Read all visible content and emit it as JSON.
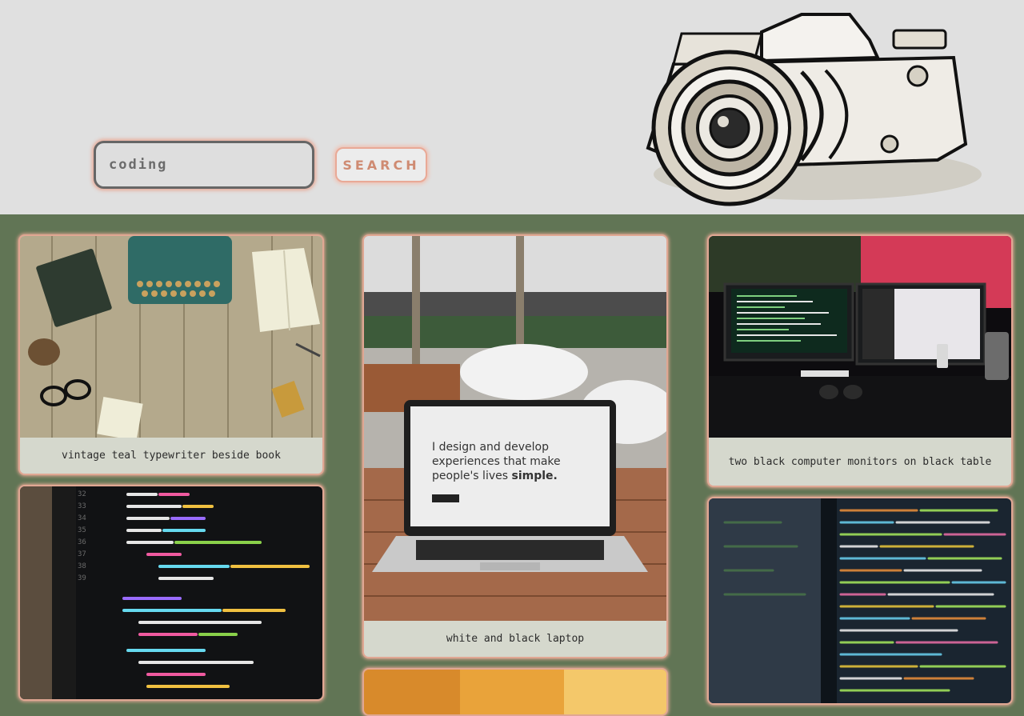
{
  "search": {
    "value": "coding",
    "button_label": "SEARCH"
  },
  "header": {
    "logo_icon": "camera-sketch-icon",
    "background": "#e0e0e0"
  },
  "gallery": {
    "background": "#617555",
    "accent": "#e9a996",
    "cards": [
      {
        "caption": "vintage teal typewriter beside book",
        "icon": "typewriter-photo"
      },
      {
        "caption": "white and black laptop",
        "icon": "laptop-photo"
      },
      {
        "caption": "two black computer monitors on black table",
        "icon": "monitors-photo"
      },
      {
        "caption": "",
        "icon": "code-screen-photo"
      },
      {
        "caption": "",
        "icon": "warm-light-photo"
      },
      {
        "caption": "",
        "icon": "code-blur-photo"
      }
    ]
  }
}
